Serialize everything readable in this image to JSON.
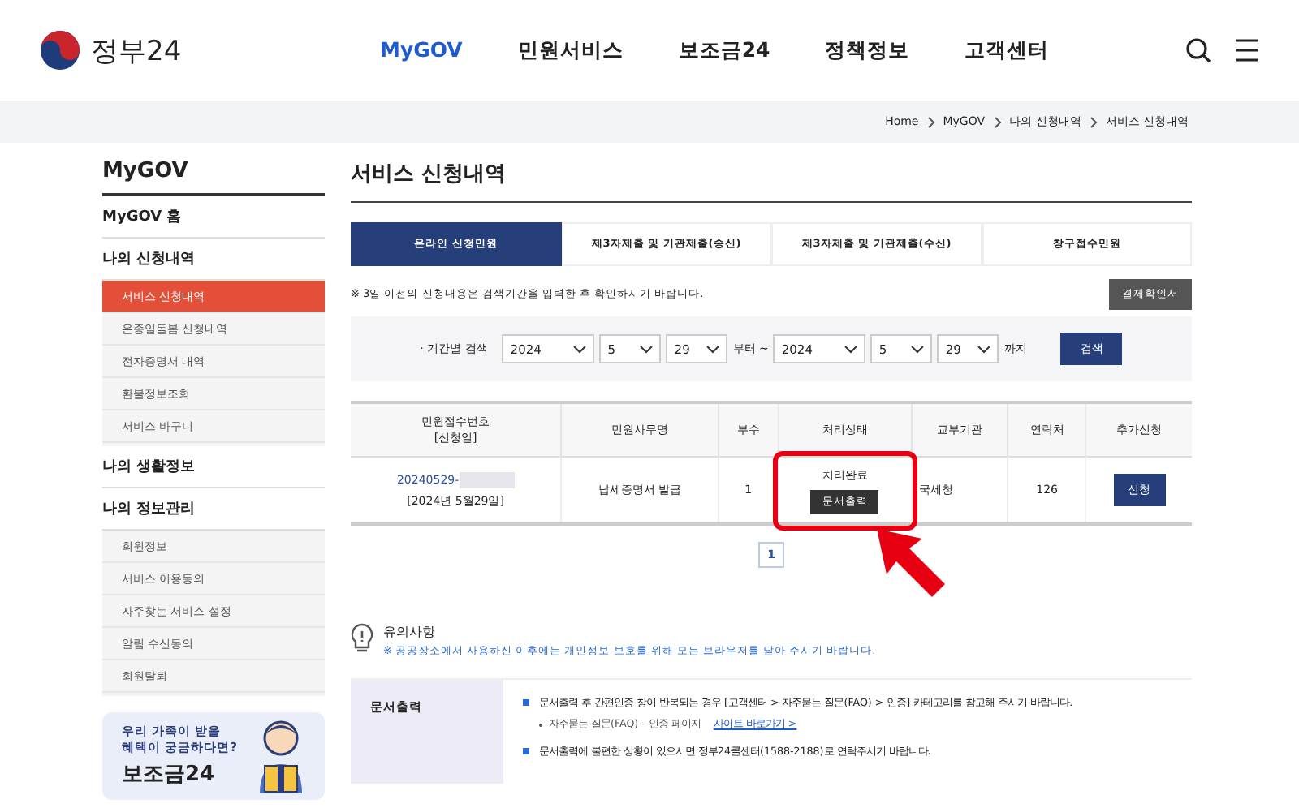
{
  "header": {
    "logo_text": "정부24",
    "nav": [
      {
        "label": "MyGOV",
        "selected": true
      },
      {
        "label": "민원서비스",
        "selected": false
      },
      {
        "label": "보조금24",
        "selected": false
      },
      {
        "label": "정책정보",
        "selected": false
      },
      {
        "label": "고객센터",
        "selected": false
      }
    ]
  },
  "breadcrumb": [
    "Home",
    "MyGOV",
    "나의 신청내역",
    "서비스 신청내역"
  ],
  "sidebar": {
    "title": "MyGOV",
    "groups": [
      {
        "label": "MyGOV 홈"
      },
      {
        "label": "나의 신청내역",
        "items": [
          {
            "label": "서비스 신청내역",
            "selected": true
          },
          {
            "label": "온종일돌봄 신청내역",
            "selected": false
          },
          {
            "label": "전자증명서 내역",
            "selected": false
          },
          {
            "label": "환불정보조회",
            "selected": false
          },
          {
            "label": "서비스 바구니",
            "selected": false
          }
        ]
      },
      {
        "label": "나의 생활정보"
      },
      {
        "label": "나의 정보관리",
        "items": [
          {
            "label": "회원정보",
            "selected": false
          },
          {
            "label": "서비스 이용동의",
            "selected": false
          },
          {
            "label": "자주찾는 서비스 설정",
            "selected": false
          },
          {
            "label": "알림 수신동의",
            "selected": false
          },
          {
            "label": "회원탈퇴",
            "selected": false
          }
        ]
      }
    ],
    "banner": {
      "line_1": "우리 가족이 받을",
      "line_2": "혜택이 궁금하다면?",
      "brand": "보조금24"
    }
  },
  "main": {
    "title": "서비스 신청내역",
    "tabs": [
      {
        "label": "온라인 신청민원",
        "selected": true
      },
      {
        "label": "제3자제출 및 기관제출(송신)",
        "selected": false
      },
      {
        "label": "제3자제출 및 기관제출(수신)",
        "selected": false
      },
      {
        "label": "창구접수민원",
        "selected": false
      }
    ],
    "note": "※ 3일 이전의 신청내용은 검색기간을 입력한 후 확인하시기 바랍니다.",
    "receipt_button": "결제확인서",
    "search": {
      "label": "· 기간별 검색",
      "from": [
        "2024",
        "5",
        "29"
      ],
      "from_suffix": "부터 ~",
      "to": [
        "2024",
        "5",
        "29"
      ],
      "to_suffix": "까지",
      "button": "검색"
    },
    "table": {
      "columns": [
        "민원접수번호\n[신청일]",
        "민원사무명",
        "부수",
        "처리상태",
        "교부기관",
        "연락처",
        "추가신청"
      ],
      "rows": [
        {
          "number": "20240529-",
          "date": "[2024년 5월29일]",
          "service": "납세증명서 발급",
          "copies": "1",
          "status": "처리완료",
          "print_button": "문서출력",
          "agency": "국세청",
          "contact": "126",
          "apply_button": "신청",
          "highlighted": true
        }
      ]
    },
    "pagination": [
      {
        "label": "1",
        "selected": true
      }
    ],
    "notice": {
      "title": "유의사항",
      "text": "※ 공공장소에서 사용하신 이후에는 개인정보 보호를 위해 모든 브라우저를 닫아 주시기 바랍니다."
    },
    "help": {
      "heading": "문서출력",
      "items": [
        {
          "text": "문서출력 후 간편인증 창이 반복되는 경우 [고객센터 > 자주묻는 질문(FAQ) > 인증] 카테고리를 참고해 주시기 바랍니다.",
          "sub": "자주묻는 질문(FAQ) - 인증 페이지",
          "link": "사이트 바로가기 >"
        },
        {
          "text": "문서출력에 불편한 상황이 있으시면 정부24콜센터(1588-2188)로 연락주시기 바랍니다."
        }
      ]
    }
  }
}
